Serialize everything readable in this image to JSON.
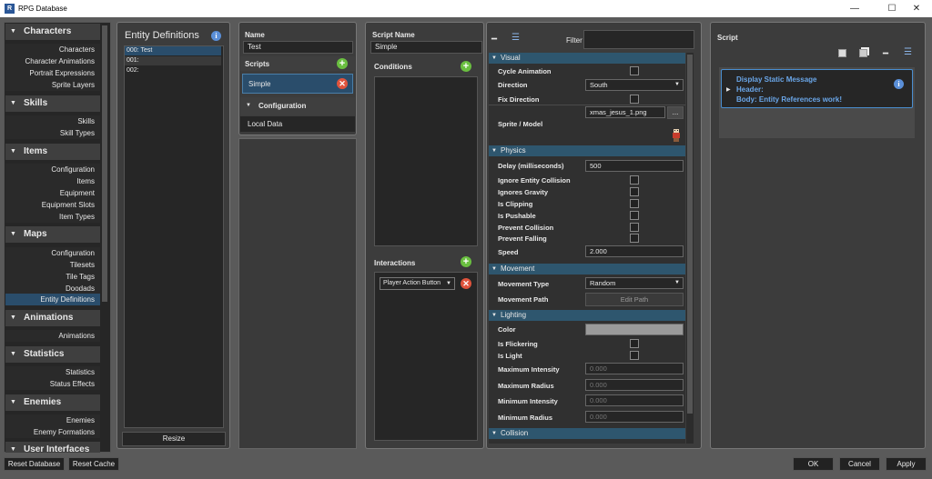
{
  "window": {
    "title": "RPG Database",
    "minimize": "—",
    "maximize": "☐",
    "close": "✕"
  },
  "sidebar": {
    "characters": {
      "title": "Characters",
      "items": [
        "Characters",
        "Character Animations",
        "Portrait Expressions",
        "Sprite Layers"
      ]
    },
    "skills": {
      "title": "Skills",
      "items": [
        "Skills",
        "Skill Types"
      ]
    },
    "items": {
      "title": "Items",
      "items": [
        "Configuration",
        "Items",
        "Equipment",
        "Equipment Slots",
        "Item Types"
      ]
    },
    "maps": {
      "title": "Maps",
      "items": [
        "Configuration",
        "Tilesets",
        "Tile Tags",
        "Doodads",
        "Entity Definitions"
      ]
    },
    "animations": {
      "title": "Animations",
      "items": [
        "Animations"
      ]
    },
    "statistics": {
      "title": "Statistics",
      "items": [
        "Statistics",
        "Status Effects"
      ]
    },
    "enemies": {
      "title": "Enemies",
      "items": [
        "Enemies",
        "Enemy Formations"
      ]
    },
    "user_interfaces": {
      "title": "User Interfaces"
    }
  },
  "entities": {
    "title": "Entity Definitions",
    "items": [
      "000: Test",
      "001:",
      "002:"
    ],
    "resize": "Resize"
  },
  "entity": {
    "name_label": "Name",
    "name_value": "Test",
    "scripts_label": "Scripts",
    "script_item": "Simple",
    "configuration_label": "Configuration",
    "local_data": "Local Data"
  },
  "script": {
    "name_label": "Script Name",
    "name_value": "Simple",
    "conditions_label": "Conditions",
    "interactions_label": "Interactions",
    "interaction_value": "Player Action Button"
  },
  "props": {
    "filter_label": "Filter",
    "visual": "Visual",
    "cycle_animation": "Cycle Animation",
    "direction": "Direction",
    "direction_value": "South",
    "fix_direction": "Fix Direction",
    "sprite_model": "Sprite / Model",
    "sprite_value": "xmas_jesus_1.png",
    "browse": "...",
    "physics": "Physics",
    "delay": "Delay (milliseconds)",
    "delay_value": "500",
    "ignore_entity_collision": "Ignore Entity Collision",
    "ignores_gravity": "Ignores Gravity",
    "is_clipping": "Is Clipping",
    "is_pushable": "Is Pushable",
    "prevent_collision": "Prevent Collision",
    "prevent_falling": "Prevent Falling",
    "speed": "Speed",
    "speed_value": "2.000",
    "movement": "Movement",
    "movement_type": "Movement Type",
    "movement_type_value": "Random",
    "movement_path": "Movement Path",
    "edit_path": "Edit Path",
    "lighting": "Lighting",
    "color": "Color",
    "is_flickering": "Is Flickering",
    "is_light": "Is Light",
    "max_intensity": "Maximum Intensity",
    "max_intensity_value": "0.000",
    "max_radius": "Maximum Radius",
    "max_radius_value": "0.000",
    "min_intensity": "Minimum Intensity",
    "min_intensity_value": "0.000",
    "min_radius": "Minimum Radius",
    "min_radius_value": "0.000",
    "collision": "Collision"
  },
  "script_panel": {
    "title": "Script",
    "command_title": "Display Static Message",
    "command_header": "Header:",
    "command_body": "Body: Entity References work!"
  },
  "footer": {
    "reset_database": "Reset Database",
    "reset_cache": "Reset Cache",
    "ok": "OK",
    "cancel": "Cancel",
    "apply": "Apply"
  },
  "colors": {
    "selection": "#2a4d6b",
    "category": "#2e566e",
    "accent_blue": "#5a8fd8",
    "add_green": "#6abf40",
    "remove_red": "#e0533c"
  }
}
